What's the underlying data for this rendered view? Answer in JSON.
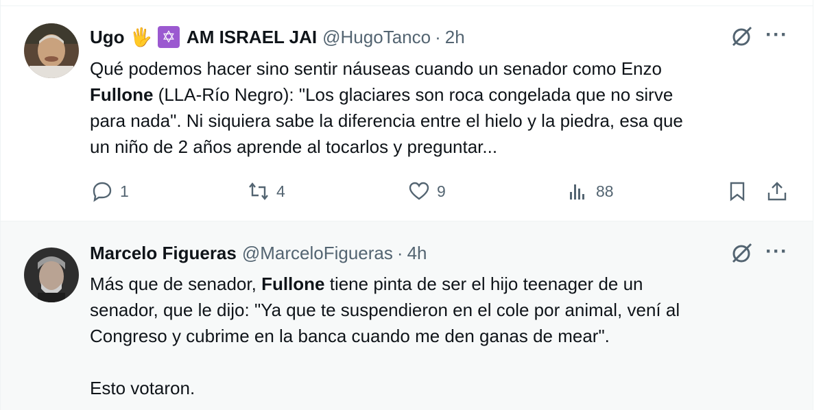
{
  "tweets": [
    {
      "display_name_prefix": "Ugo",
      "display_name_emoji": "🖐",
      "display_name_badge": "✡",
      "display_name_suffix": "AM ISRAEL JAI",
      "handle": "@HugoTanco",
      "separator": "·",
      "time": "2h",
      "text_part1": "Qué podemos hacer sino sentir náuseas cuando un senador como Enzo\n",
      "text_bold": "Fullone",
      "text_part2": " (LLA-Río Negro): \"Los glaciares son roca congelada que no sirve\npara nada\". Ni siquiera sabe la diferencia entre el hielo y la piedra, esa que\nun niño de 2 años aprende al tocarlos y preguntar...",
      "replies": "1",
      "reposts": "4",
      "likes": "9",
      "views": "88",
      "avatar_colors": [
        "#6b4f3a",
        "#c9b79a"
      ]
    },
    {
      "display_name": "Marcelo Figueras",
      "handle": "@MarceloFigueras",
      "separator": "·",
      "time": "4h",
      "text_part1": "Más que de senador, ",
      "text_bold": "Fullone",
      "text_part2": " tiene pinta de ser el hijo teenager de un\nsenador, que le dijo: \"Ya que te suspendieron en el cole por animal, vení al\nCongreso y cubrime en la banca cuando me den ganas de mear\".\n\nEsto votaron.",
      "avatar_colors": [
        "#3c3c3c",
        "#9a9a9a"
      ]
    }
  ],
  "icons": {
    "grok": "grok-icon",
    "more": "more-icon",
    "reply": "reply-icon",
    "repost": "repost-icon",
    "like": "like-icon",
    "views": "views-icon",
    "bookmark": "bookmark-icon",
    "share": "share-icon"
  },
  "colors": {
    "text": "#0f1419",
    "secondary": "#536471",
    "border": "#eff3f4",
    "reply_bg": "#f7f9f9"
  }
}
